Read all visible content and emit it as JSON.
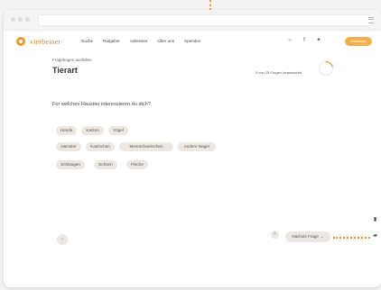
{
  "nav": {
    "logo_text": "vierbeiner",
    "links": [
      "Suche",
      "Ratgeber",
      "Adressen",
      "Über uns",
      "Spenden"
    ],
    "signup_label": "Anmelden"
  },
  "quiz": {
    "breadcrumb": "Fragebogen ausfüllen",
    "title": "Tierart",
    "progress_text": "3 von 15 Fragen beantwortet",
    "progress_fraction": 0.2,
    "question": "Für welches Haustier interessieren du dich?",
    "options": [
      "Hunde",
      "Katzen",
      "Vögel",
      "Hamster",
      "Kaninchen",
      "Meerschweinchen",
      "Andere Nager",
      "Schlangen",
      "Echsen",
      "Fische"
    ],
    "next_label": "Nächste Frage →",
    "prev_label": "‹",
    "skip_label": "×"
  },
  "colors": {
    "accent": "#f0962a",
    "chip_bg": "#ece7e1"
  }
}
